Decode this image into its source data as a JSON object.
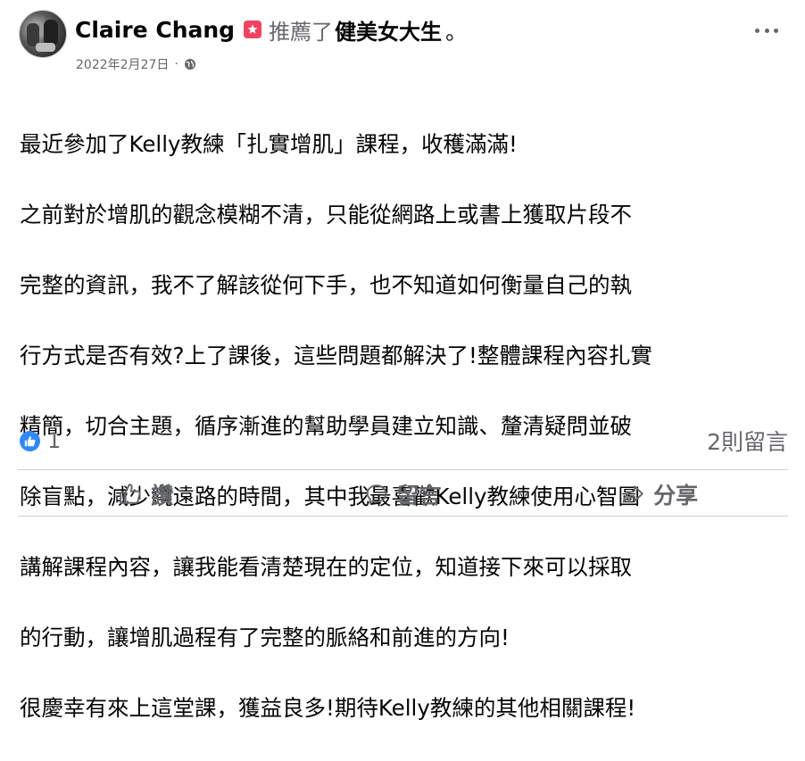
{
  "post": {
    "author": "Claire Chang",
    "action": "推薦了",
    "page": "健美女大生",
    "period": "。",
    "date": "2022年2月27日",
    "separator": "·",
    "privacy_icon": "globe-icon",
    "body_lines": [
      "最近參加了Kelly教練「扎實增肌」課程，收穫滿滿!",
      "之前對於增肌的觀念模糊不清，只能從網路上或書上獲取片段不",
      "完整的資訊，我不了解該從何下手，也不知道如何衡量自己的執",
      "行方式是否有效?上了課後，這些問題都解決了!整體課程內容扎實",
      "精簡，切合主題，循序漸進的幫助學員建立知識、釐清疑問並破",
      "除盲點，減少繞遠路的時間，其中我最喜歡Kelly教練使用心智圖",
      "講解課程內容，讓我能看清楚現在的定位，知道接下來可以採取",
      "的行動，讓增肌過程有了完整的脈絡和前進的方向!",
      "很慶幸有來上這堂課，獲益良多!期待Kelly教練的其他相關課程!"
    ],
    "reaction_count": "1",
    "comments_count": "2則留言"
  },
  "actions": {
    "like": "讚",
    "comment": "留言",
    "share": "分享"
  },
  "colors": {
    "accent": "#2e89ff",
    "recommend": "#f3425f",
    "secondary_text": "#65676b"
  }
}
